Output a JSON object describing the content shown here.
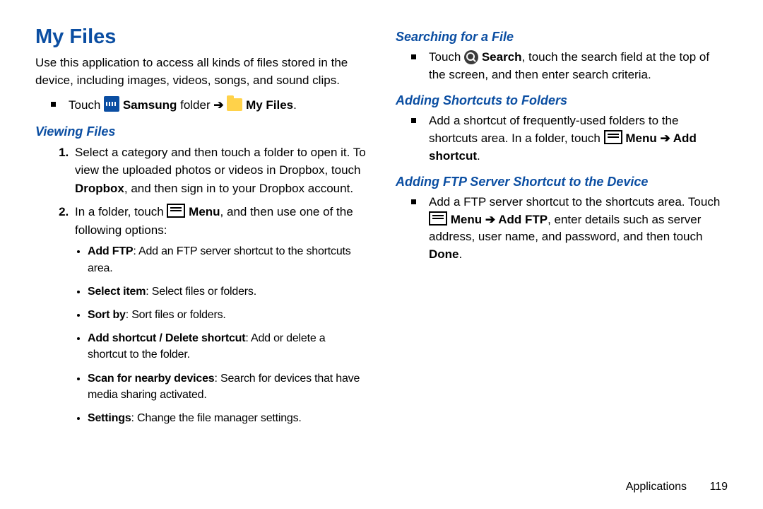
{
  "title": "My Files",
  "intro": "Use this application to access all kinds of files stored in the device, including images, videos, songs, and sound clips.",
  "nav": {
    "touch": "Touch ",
    "samsung": "Samsung",
    "folder_word": " folder ",
    "arrow": "➔",
    "myfiles": "My Files",
    "period": "."
  },
  "sections": {
    "viewing": "Viewing Files",
    "searching": "Searching for a File",
    "shortcuts": "Adding Shortcuts to Folders",
    "ftp": "Adding FTP Server Shortcut to the Device"
  },
  "viewing_steps": {
    "s1a": "Select a category and then touch a folder to open it. To view the uploaded photos or videos in Dropbox, touch ",
    "s1b": "Dropbox",
    "s1c": ", and then sign in to your Dropbox account.",
    "s2a": "In a folder, touch ",
    "s2b": "Menu",
    "s2c": ", and then use one of the following options:"
  },
  "options": [
    {
      "t": "Add FTP",
      "d": ": Add an FTP server shortcut to the shortcuts area."
    },
    {
      "t": "Select item",
      "d": ": Select files or folders."
    },
    {
      "t": "Sort by",
      "d": ": Sort files or folders."
    },
    {
      "t": "Add shortcut / Delete shortcut",
      "d": ": Add or delete a shortcut to the folder."
    },
    {
      "t": "Scan for nearby devices",
      "d": ": Search for devices that have media sharing activated."
    },
    {
      "t": "Settings",
      "d": ": Change the file manager settings."
    }
  ],
  "searching": {
    "a": "Touch ",
    "b": "Search",
    "c": ", touch the search field at the top of the screen, and then enter search criteria."
  },
  "shortcuts": {
    "a": "Add a shortcut of frequently-used folders to the shortcuts area. In a folder, touch ",
    "menu": "Menu",
    "arrow": " ➔ ",
    "add": "Add shortcut",
    "end": "."
  },
  "ftp": {
    "a": "Add a FTP server shortcut to the shortcuts area. Touch ",
    "menu": "Menu",
    "arrow": " ➔ ",
    "addftp": "Add FTP",
    "b": ", enter details such as server address, user name, and password, and then touch ",
    "done": "Done",
    "end": "."
  },
  "footer": {
    "section": "Applications",
    "page": "119"
  }
}
